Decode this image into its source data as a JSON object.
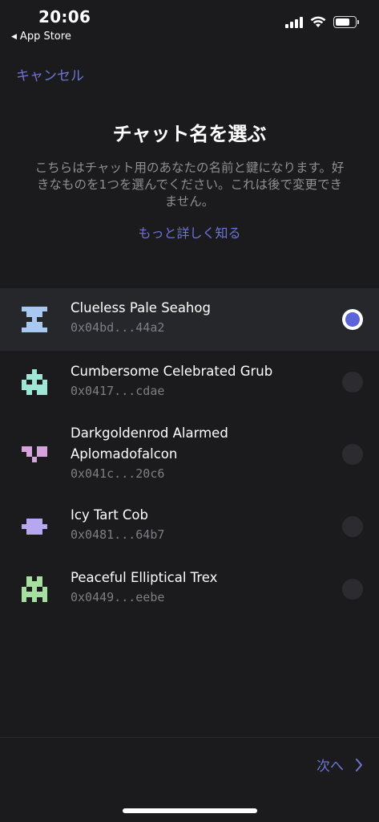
{
  "status_bar": {
    "time": "20:06",
    "back_app": "App Store",
    "back_icon": "triangle-left-icon",
    "signal_icon": "cellular-signal-icon",
    "wifi_icon": "wifi-icon",
    "battery_icon": "battery-icon"
  },
  "nav": {
    "cancel_label": "キャンセル"
  },
  "header": {
    "title": "チャット名を選ぶ",
    "description": "こちらはチャット用のあなたの名前と鍵になります。好きなものを1つを選んでください。これは後で変更できません。",
    "learn_more": "もっと詳しく知る"
  },
  "accent_color": "#6d74d6",
  "identities": [
    {
      "name": "Clueless Pale Seahog",
      "address": "0x04bd...44a2",
      "selected": true,
      "color": "#a8c8ef"
    },
    {
      "name": "Cumbersome Celebrated Grub",
      "address": "0x0417...cdae",
      "selected": false,
      "color": "#9fe6d6"
    },
    {
      "name": "Darkgoldenrod Alarmed Aplomadofalcon",
      "address": "0x041c...20c6",
      "selected": false,
      "color": "#d6a3dc"
    },
    {
      "name": "Icy Tart Cob",
      "address": "0x0481...64b7",
      "selected": false,
      "color": "#b7a6f0"
    },
    {
      "name": "Peaceful Elliptical Trex",
      "address": "0x0449...eebe",
      "selected": false,
      "color": "#a6e0a0"
    }
  ],
  "footer": {
    "next_label": "次へ",
    "next_icon": "chevron-right-icon"
  }
}
